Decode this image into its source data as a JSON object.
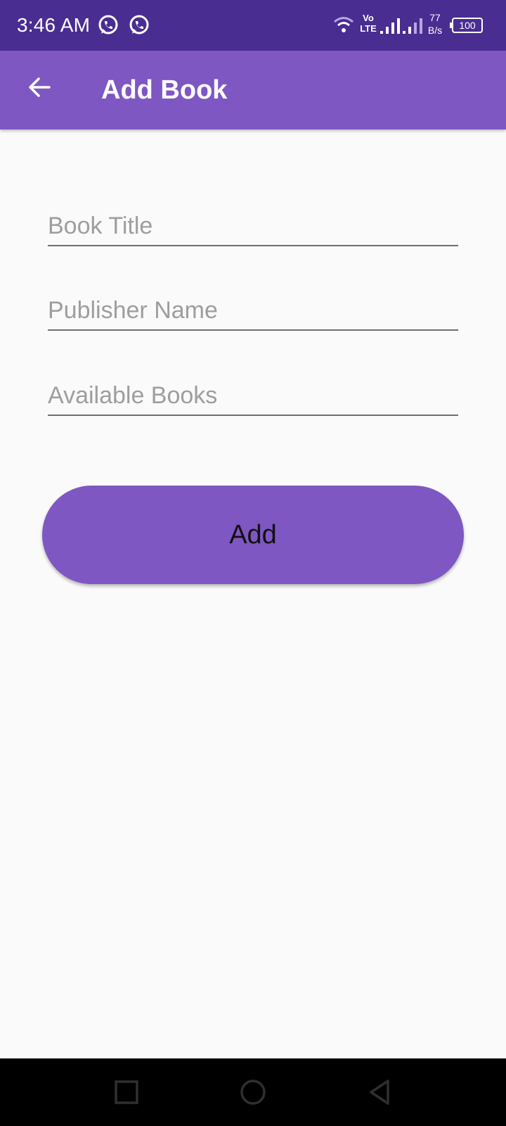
{
  "status_bar": {
    "time": "3:46 AM",
    "volte_top": "Vo",
    "volte_bottom": "LTE",
    "net_speed_value": "77",
    "net_speed_unit": "B/s",
    "battery_level": "100"
  },
  "app_bar": {
    "title": "Add Book",
    "back_icon": "arrow-back-icon"
  },
  "form": {
    "book_title": {
      "placeholder": "Book Title",
      "value": ""
    },
    "publisher_name": {
      "placeholder": "Publisher Name",
      "value": ""
    },
    "available_books": {
      "placeholder": "Available Books",
      "value": ""
    }
  },
  "actions": {
    "add_label": "Add"
  },
  "nav_bar": {
    "recents_icon": "square-icon",
    "home_icon": "circle-icon",
    "back_icon": "triangle-back-icon"
  },
  "colors": {
    "status_bar": "#4a2d90",
    "primary": "#7e57c2",
    "background": "#fafafa",
    "underline": "#6f6f6f",
    "placeholder": "#9e9e9e"
  }
}
